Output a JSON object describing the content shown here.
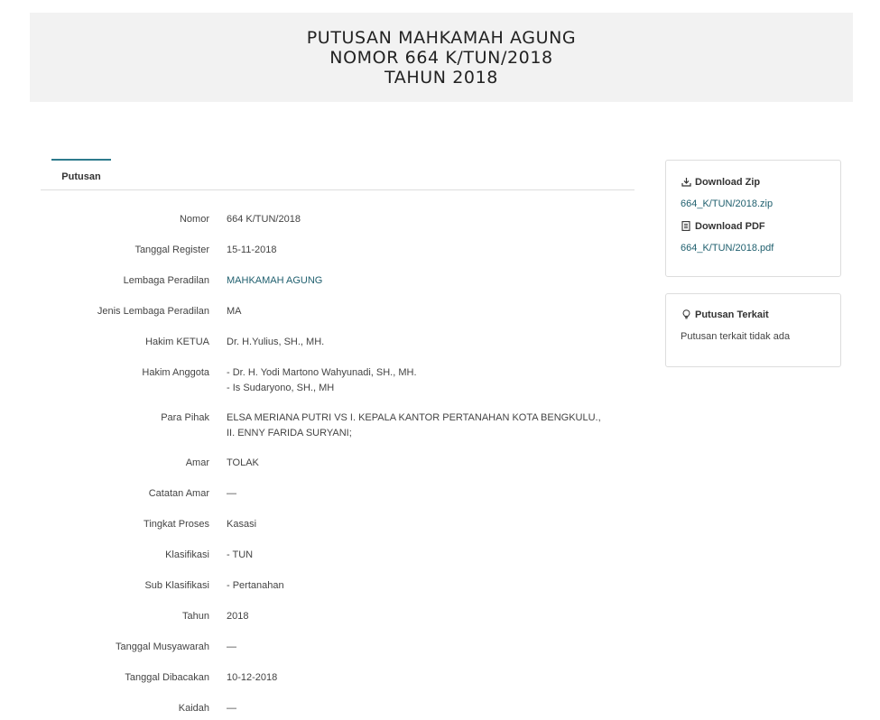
{
  "header": {
    "line1": "PUTUSAN MAHKAMAH AGUNG",
    "line2": "NOMOR 664 K/TUN/2018",
    "line3": "TAHUN 2018"
  },
  "tabs": [
    {
      "label": "Putusan",
      "active": true
    }
  ],
  "details": {
    "nomor": {
      "label": "Nomor",
      "value": "664 K/TUN/2018"
    },
    "tanggal_register": {
      "label": "Tanggal Register",
      "value": "15-11-2018"
    },
    "lembaga_peradilan": {
      "label": "Lembaga Peradilan",
      "value": "MAHKAMAH AGUNG"
    },
    "jenis_lembaga": {
      "label": "Jenis Lembaga Peradilan",
      "value": "MA"
    },
    "hakim_ketua": {
      "label": "Hakim KETUA",
      "value": "Dr. H.Yulius, SH., MH."
    },
    "hakim_anggota": {
      "label": "Hakim Anggota",
      "values": [
        "- Dr. H. Yodi Martono Wahyunadi, SH., MH.",
        "- Is Sudaryono, SH., MH"
      ]
    },
    "para_pihak": {
      "label": "Para Pihak",
      "value": "ELSA MERIANA PUTRI VS I. KEPALA KANTOR PERTANAHAN KOTA BENGKULU., II. ENNY FARIDA SURYANI;"
    },
    "amar": {
      "label": "Amar",
      "value": "TOLAK"
    },
    "catatan_amar": {
      "label": "Catatan Amar",
      "value": "—"
    },
    "tingkat_proses": {
      "label": "Tingkat Proses",
      "value": "Kasasi"
    },
    "klasifikasi": {
      "label": "Klasifikasi",
      "value": "- TUN"
    },
    "sub_klasifikasi": {
      "label": "Sub Klasifikasi",
      "value": "- Pertanahan"
    },
    "tahun": {
      "label": "Tahun",
      "value": "2018"
    },
    "tanggal_musyawarah": {
      "label": "Tanggal Musyawarah",
      "value": "—"
    },
    "tanggal_dibacakan": {
      "label": "Tanggal Dibacakan",
      "value": "10-12-2018"
    },
    "kaidah": {
      "label": "Kaidah",
      "value": "—"
    }
  },
  "sidebar": {
    "download_zip": {
      "heading": "Download Zip",
      "file": "664_K/TUN/2018.zip",
      "icon": "download-icon"
    },
    "download_pdf": {
      "heading": "Download PDF",
      "file": "664_K/TUN/2018.pdf",
      "icon": "file-pdf-icon"
    },
    "related": {
      "heading": "Putusan Terkait",
      "text": "Putusan terkait tidak ada",
      "icon": "lightbulb-icon"
    }
  },
  "colors": {
    "header_bg": "#f2f2f2",
    "link": "#1f5f6e",
    "tab_accent": "#2d7a8c"
  }
}
